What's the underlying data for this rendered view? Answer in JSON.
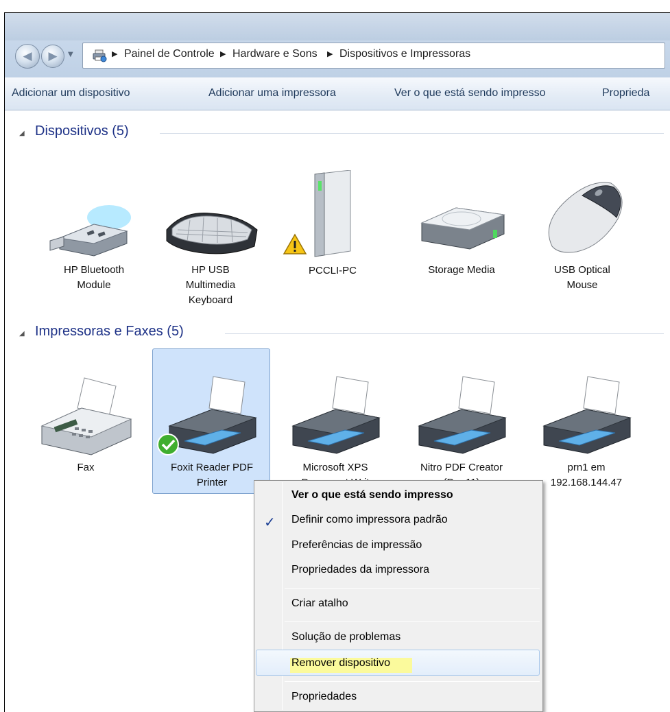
{
  "address_bar": {
    "breadcrumbs": [
      "Painel de Controle",
      "Hardware e Sons",
      "Dispositivos e Impressoras"
    ]
  },
  "command_bar": {
    "items": [
      "Adicionar um dispositivo",
      "Adicionar uma impressora",
      "Ver o que está sendo impresso",
      "Proprieda"
    ]
  },
  "groups": {
    "devices": {
      "title": "Dispositivos (5)",
      "items": [
        {
          "label_lines": [
            "HP Bluetooth",
            "Module"
          ],
          "icon": "usb-bluetooth-dongle-icon"
        },
        {
          "label_lines": [
            "HP USB",
            "Multimedia",
            "Keyboard"
          ],
          "icon": "keyboard-icon"
        },
        {
          "label_lines": [
            "PCCLI-PC"
          ],
          "icon": "computer-tower-icon",
          "warning": true
        },
        {
          "label_lines": [
            "Storage Media"
          ],
          "icon": "external-drive-icon"
        },
        {
          "label_lines": [
            "USB Optical",
            "Mouse"
          ],
          "icon": "mouse-icon"
        }
      ]
    },
    "printers": {
      "title": "Impressoras e Faxes (5)",
      "items": [
        {
          "label_lines": [
            "Fax"
          ],
          "icon": "fax-icon"
        },
        {
          "label_lines": [
            "Foxit Reader PDF",
            "Printer"
          ],
          "icon": "printer-icon",
          "default": true,
          "selected": true
        },
        {
          "label_lines": [
            "Microsoft XPS",
            "Document Writ"
          ],
          "icon": "printer-icon"
        },
        {
          "label_lines": [
            "Nitro PDF Creator",
            "(Pro 11)"
          ],
          "icon": "printer-icon"
        },
        {
          "label_lines": [
            "prn1 em",
            "192.168.144.47"
          ],
          "icon": "printer-icon"
        }
      ]
    }
  },
  "context_menu": {
    "items": [
      {
        "label": "Ver o que está sendo impresso",
        "bold": true
      },
      {
        "label": "Definir como impressora padrão",
        "checked": true
      },
      {
        "label": "Preferências de impressão"
      },
      {
        "label": "Propriedades da impressora"
      },
      {
        "label": "Criar atalho"
      },
      {
        "label": "Solução de problemas"
      },
      {
        "label": "Remover dispositivo",
        "hovered": true,
        "highlight_color": "#fbfa9c"
      },
      {
        "label": "Propriedades"
      }
    ]
  },
  "colors": {
    "group_title": "#1e3287",
    "command_text": "#1e395b",
    "selection_bg": "#cfe3fb",
    "check_mark": "#1c3f94"
  }
}
